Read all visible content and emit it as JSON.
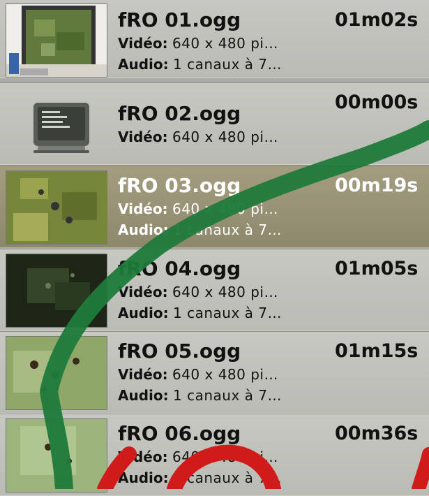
{
  "items": [
    {
      "title": "fRO 01.ogg",
      "duration": "01m02s",
      "video_label": "Vidéo:",
      "video_value": "640 x 480 pi…",
      "audio_label": "Audio:",
      "audio_value": "1 canaux à 7…",
      "thumb_icon": "screen-photo-thumbnail"
    },
    {
      "title": "fRO 02.ogg",
      "duration": "00m00s",
      "video_label": "Vidéo:",
      "video_value": "640 x 480 pi…",
      "audio_label": "",
      "audio_value": "",
      "thumb_icon": "monitor-icon"
    },
    {
      "title": "fRO 03.ogg",
      "duration": "00m19s",
      "video_label": "Vidéo:",
      "video_value": "640 x 480 pi…",
      "audio_label": "Audio:",
      "audio_value": "1 canaux à 7…",
      "thumb_icon": "game-map-thumbnail"
    },
    {
      "title": "fRO 04.ogg",
      "duration": "01m05s",
      "video_label": "Vidéo:",
      "video_value": "640 x 480 pi…",
      "audio_label": "Audio:",
      "audio_value": "1 canaux à 7…",
      "thumb_icon": "dark-map-thumbnail"
    },
    {
      "title": "fRO 05.ogg",
      "duration": "01m15s",
      "video_label": "Vidéo:",
      "video_value": "640 x 480 pi…",
      "audio_label": "Audio:",
      "audio_value": "1 canaux à 7…",
      "thumb_icon": "green-map-thumbnail"
    },
    {
      "title": "fRO 06.ogg",
      "duration": "00m36s",
      "video_label": "Vidéo:",
      "video_value": "640 x 480 pi…",
      "audio_label": "Audio:",
      "audio_value": "1 canaux à 7…",
      "thumb_icon": "green-map-thumbnail"
    }
  ],
  "selected_index": 2,
  "colors": {
    "selection": "#948d72",
    "checkmark": "#1f7a3a",
    "red_mark": "#d11a1a"
  }
}
